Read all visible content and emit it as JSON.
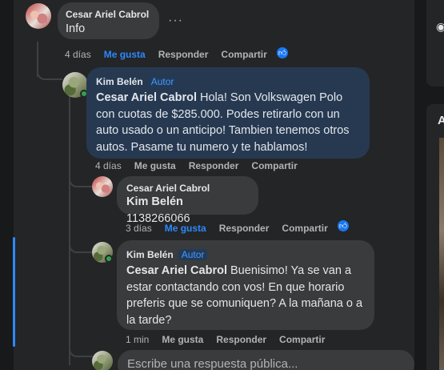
{
  "comment1": {
    "author": "Cesar Ariel Cabrol",
    "text": "Info",
    "time": "4 días",
    "like_label": "Me gusta",
    "reply_label": "Responder",
    "share_label": "Compartir"
  },
  "comment2": {
    "author": "Kim Belén",
    "badge": "Autor",
    "mention": "Cesar Ariel Cabrol",
    "text": "Hola! Son Volkswagen Polo con cuotas de $285.000. Podes retirarlo con un auto usado o un anticipo! Tambien tenemos otros autos. Pasame tu numero y te hablamos!",
    "time": "4 días",
    "like_label": "Me gusta",
    "reply_label": "Responder",
    "share_label": "Compartir"
  },
  "comment3": {
    "author": "Cesar Ariel Cabrol",
    "mention": "Kim Belén",
    "text": "1138266066",
    "time": "3 días",
    "like_label": "Me gusta",
    "reply_label": "Responder",
    "share_label": "Compartir"
  },
  "comment4": {
    "author": "Kim Belén",
    "badge": "Autor",
    "mention": "Cesar Ariel Cabrol",
    "text": "Buenisimo! Ya se van a estar contactando con vos! En que horario preferis que se comuniquen? A la mañana o a la tarde?",
    "time": "1 min",
    "like_label": "Me gusta",
    "reply_label": "Responder",
    "share_label": "Compartir"
  },
  "reply_box": {
    "placeholder": "Escribe una respuesta pública..."
  },
  "side": {
    "letter": "A"
  },
  "icons": {
    "more": "more-options-icon",
    "like_reaction": "thumbs-up-icon",
    "eye": "eye-icon"
  },
  "colors": {
    "liked": "#2d88ff",
    "author_bubble": "#263951",
    "bubble": "#3a3b3c"
  }
}
